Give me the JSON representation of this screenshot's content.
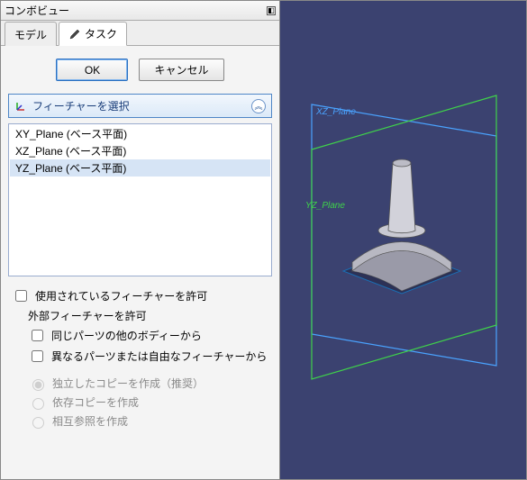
{
  "panel": {
    "title": "コンボビュー"
  },
  "tabs": {
    "model": "モデル",
    "task": "タスク"
  },
  "buttons": {
    "ok": "OK",
    "cancel": "キャンセル"
  },
  "section": {
    "title": "フィーチャーを選択"
  },
  "planes": {
    "items": [
      "XY_Plane (ベース平面)",
      "XZ_Plane (ベース平面)",
      "YZ_Plane (ベース平面)"
    ]
  },
  "options": {
    "allow_used": "使用されているフィーチャーを許可",
    "external_label": "外部フィーチャーを許可",
    "from_other_bodies": "同じパーツの他のボディーから",
    "from_other_parts": "異なるパーツまたは自由なフィーチャーから",
    "copy_independent": "独立したコピーを作成（推奨）",
    "copy_dependent": "依存コピーを作成",
    "cross_reference": "相互参照を作成"
  },
  "viewport": {
    "labels": {
      "xz": "XZ_Plane",
      "yz": "YZ_Plane"
    },
    "colors": {
      "xz": "#4aa3ff",
      "yz": "#3fd24a",
      "bg": "#3b4270"
    }
  }
}
